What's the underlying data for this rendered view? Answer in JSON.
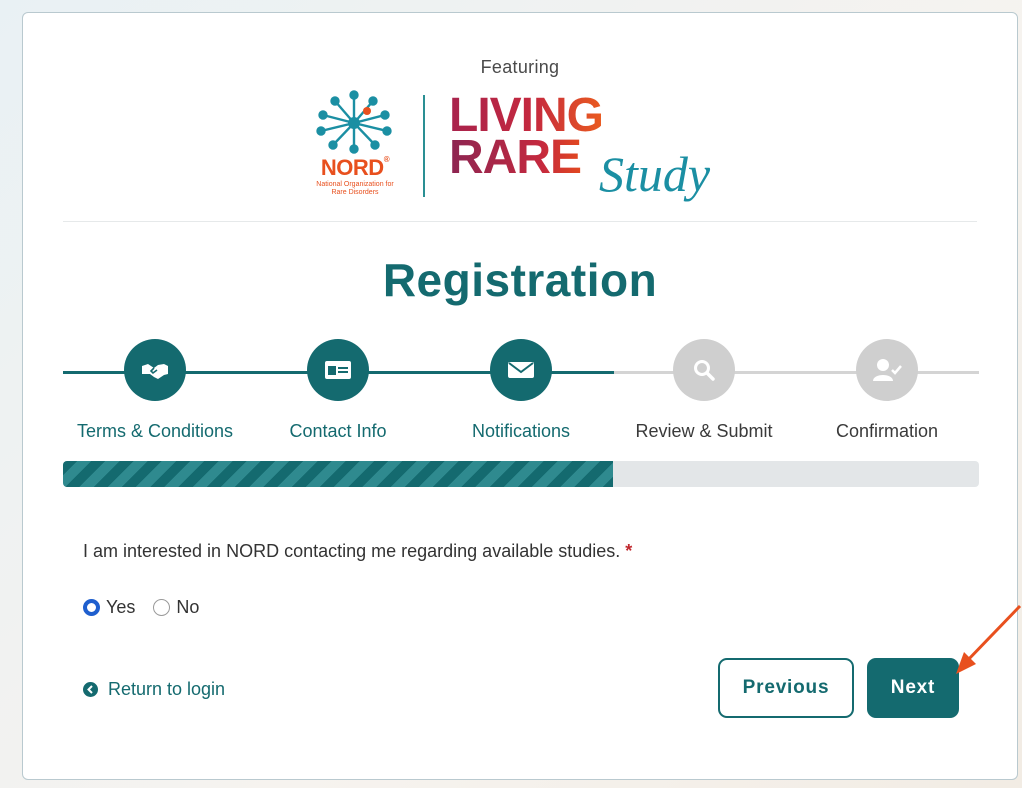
{
  "header": {
    "featuring": "Featuring",
    "nord_logo_text": "NORD",
    "nord_logo_subtitle": "National Organization for Rare Disorders",
    "study_logo_line1": "LIVING",
    "study_logo_line2": "RARE",
    "study_logo_line3": "Study"
  },
  "page_title": "Registration",
  "steps": [
    {
      "label": "Terms & Conditions",
      "icon": "handshake-icon",
      "status": "complete"
    },
    {
      "label": "Contact Info",
      "icon": "id-card-icon",
      "status": "complete"
    },
    {
      "label": "Notifications",
      "icon": "envelope-icon",
      "status": "current"
    },
    {
      "label": "Review & Submit",
      "icon": "search-icon",
      "status": "pending"
    },
    {
      "label": "Confirmation",
      "icon": "user-check-icon",
      "status": "pending"
    }
  ],
  "progress": {
    "completed_steps": 3,
    "total_steps": 5
  },
  "form": {
    "question": "I am interested in NORD contacting me regarding available studies.",
    "required_marker": "*",
    "options": [
      {
        "label": "Yes",
        "selected": true
      },
      {
        "label": "No",
        "selected": false
      }
    ]
  },
  "nav": {
    "return_label": "Return to login",
    "previous_label": "Previous",
    "next_label": "Next"
  },
  "colors": {
    "primary": "#146a6f",
    "inactive": "#cfcfcf",
    "required": "#c0272d",
    "radio_selected": "#1f5fce",
    "annotation_arrow": "#e8501e"
  }
}
